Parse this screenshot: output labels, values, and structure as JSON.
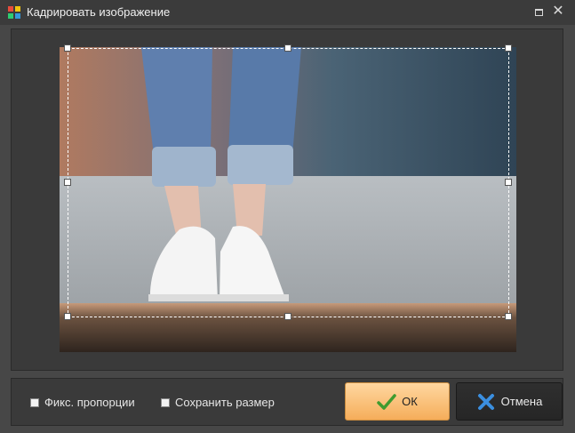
{
  "window": {
    "title": "Кадрировать изображение",
    "icons": {
      "app": "app-logo-icon",
      "maximize": "maximize-icon",
      "close": "close-icon"
    },
    "close_glyph": "✕"
  },
  "options": {
    "fix_proportions": {
      "label": "Фикс. пропорции",
      "checked": false
    },
    "keep_size": {
      "label": "Сохранить размер",
      "checked": false
    }
  },
  "buttons": {
    "ok": {
      "label": "ОК",
      "icon": "checkmark-icon",
      "color": "#f5ad5a"
    },
    "cancel": {
      "label": "Отмена",
      "icon": "x-cross-icon",
      "color": "#262626"
    }
  },
  "image": {
    "icon": "photo-preview",
    "description_colors": {
      "wall_left": "#b07a60",
      "wall_right": "#3d5566",
      "floor": "#aeb3b7",
      "wood": "#5b4637"
    }
  }
}
